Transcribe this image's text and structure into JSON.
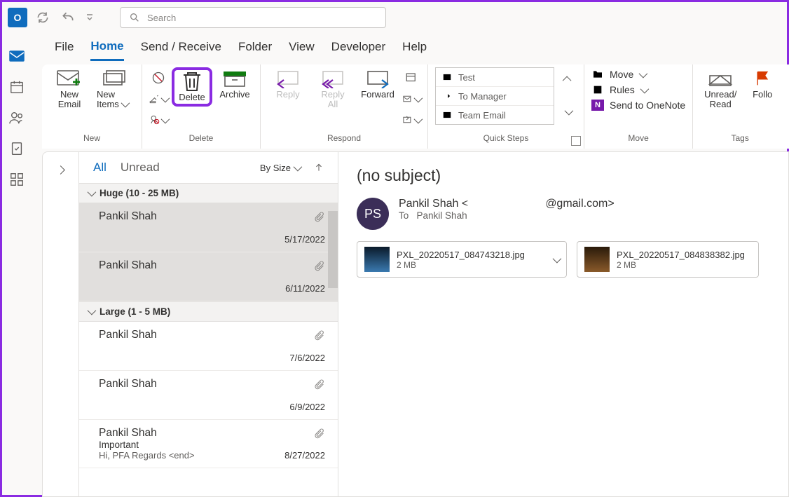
{
  "titlebar": {
    "search_placeholder": "Search"
  },
  "menu": {
    "tabs": [
      "File",
      "Home",
      "Send / Receive",
      "Folder",
      "View",
      "Developer",
      "Help"
    ],
    "active": "Home"
  },
  "ribbon": {
    "groups": {
      "new": {
        "label": "New",
        "new_email": "New Email",
        "new_items": "New Items"
      },
      "delete": {
        "label": "Delete",
        "delete": "Delete",
        "archive": "Archive"
      },
      "respond": {
        "label": "Respond",
        "reply": "Reply",
        "reply_all": "Reply All",
        "forward": "Forward"
      },
      "quicksteps": {
        "label": "Quick Steps",
        "items": [
          "Test",
          "To Manager",
          "Team Email"
        ]
      },
      "move": {
        "label": "Move",
        "move": "Move",
        "rules": "Rules",
        "onenote": "Send to OneNote"
      },
      "tags": {
        "label": "Tags",
        "unread_read": "Unread/ Read",
        "follow": "Follo"
      }
    }
  },
  "messagelist": {
    "tabs": {
      "all": "All",
      "unread": "Unread"
    },
    "sort_label": "By Size",
    "groups": [
      {
        "header": "Huge (10 - 25 MB)",
        "items": [
          {
            "from": "Pankil Shah",
            "date": "5/17/2022",
            "has_attachment": true,
            "selected": true
          },
          {
            "from": "Pankil Shah",
            "date": "6/11/2022",
            "has_attachment": true,
            "selected": true
          }
        ]
      },
      {
        "header": "Large (1 - 5 MB)",
        "items": [
          {
            "from": "Pankil Shah",
            "date": "7/6/2022",
            "has_attachment": true
          },
          {
            "from": "Pankil Shah",
            "date": "6/9/2022",
            "has_attachment": true
          },
          {
            "from": "Pankil Shah",
            "subject": "Important",
            "preview": "Hi,  PFA  Regards  <end>",
            "date": "8/27/2022",
            "has_attachment": true
          }
        ]
      }
    ]
  },
  "reading": {
    "subject": "(no subject)",
    "avatar_initials": "PS",
    "sender_name": "Pankil Shah",
    "sender_domain": "@gmail.com>",
    "sender_prefix": "Pankil Shah <",
    "to_label": "To",
    "to_name": "Pankil Shah",
    "attachments": [
      {
        "filename": "PXL_20220517_084743218.jpg",
        "size": "2 MB"
      },
      {
        "filename": "PXL_20220517_084838382.jpg",
        "size": "2 MB"
      }
    ]
  }
}
